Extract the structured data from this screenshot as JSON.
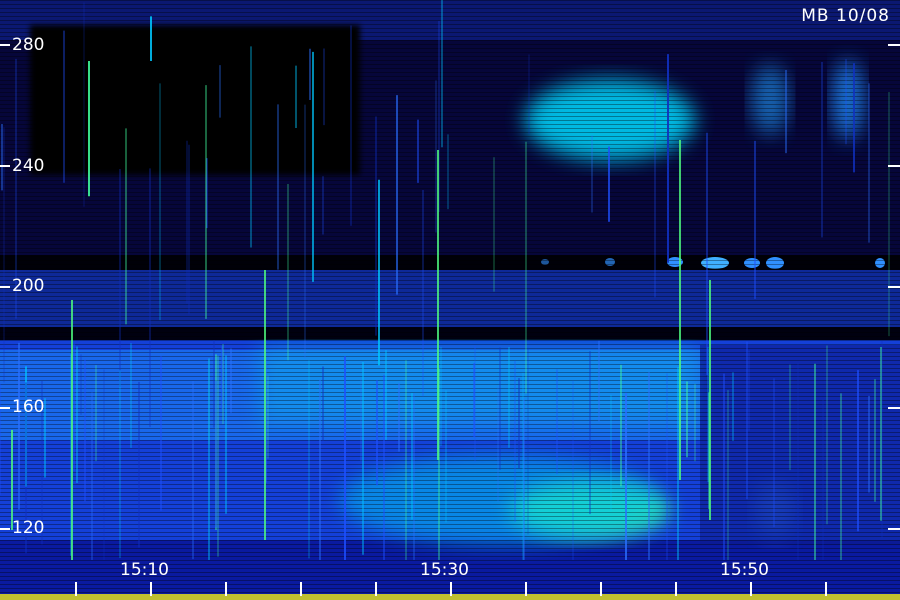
{
  "title": "MB 10/08",
  "y_axis": {
    "labels": [
      "280",
      "240",
      "200",
      "160",
      "120"
    ],
    "values": [
      280,
      240,
      200,
      160,
      120
    ]
  },
  "x_axis": {
    "labels": [
      "15:10",
      "15:30",
      "15:50"
    ]
  },
  "colors": {
    "background": "#000010",
    "low": "#0a0a60",
    "mid": "#1e50ff",
    "high": "#00e0ff",
    "peak": "#40ff90"
  }
}
